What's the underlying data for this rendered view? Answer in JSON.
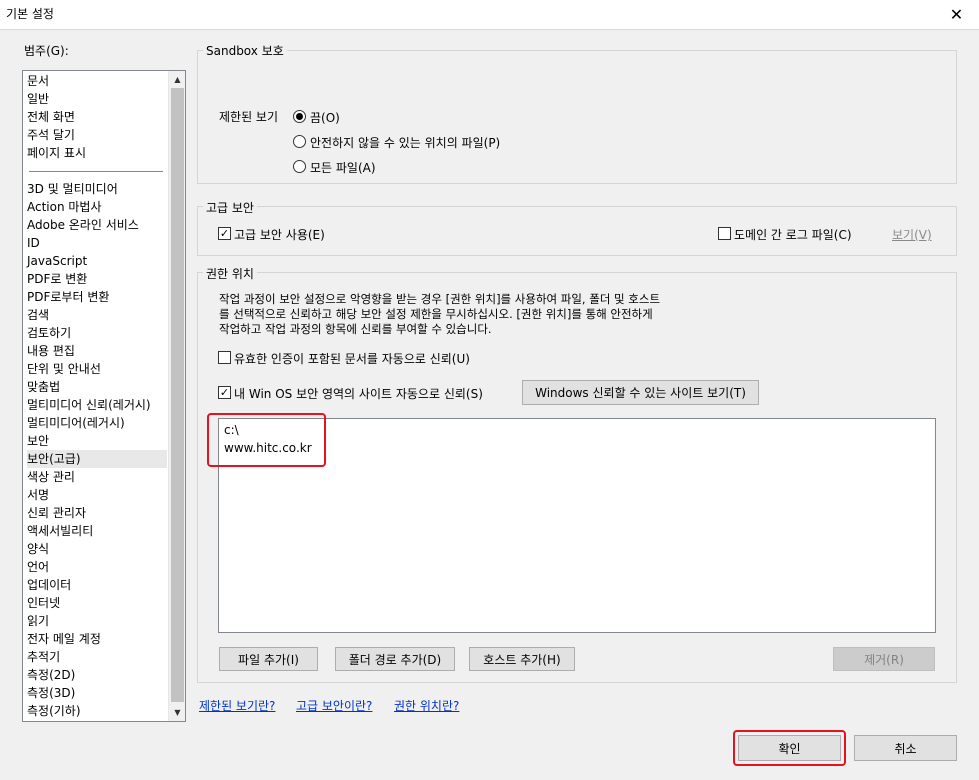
{
  "window": {
    "title": "기본 설정",
    "close": "✕"
  },
  "categories": {
    "label": "범주(G):",
    "items_top": [
      "문서",
      "일반",
      "전체 화면",
      "주석 달기",
      "페이지 표시"
    ],
    "items_bottom": [
      "3D 및 멀티미디어",
      "Action 마법사",
      "Adobe 온라인 서비스",
      "ID",
      "JavaScript",
      "PDF로 변환",
      "PDF로부터 변환",
      "검색",
      "검토하기",
      "내용 편집",
      "단위 및 안내선",
      "맞춤법",
      "멀티미디어 신뢰(레거시)",
      "멀티미디어(레거시)",
      "보안",
      "보안(고급)",
      "색상 관리",
      "서명",
      "신뢰 관리자",
      "액세서빌리티",
      "양식",
      "언어",
      "업데이터",
      "인터넷",
      "읽기",
      "전자 메일 계정",
      "추적기",
      "측정(2D)",
      "측정(3D)",
      "측정(기하)"
    ],
    "selected": "보안(고급)"
  },
  "sandbox": {
    "title": "Sandbox 보호",
    "protected_view_label": "제한된 보기",
    "options": [
      "끔(O)",
      "안전하지 않을 수 있는 위치의 파일(P)",
      "모든 파일(A)"
    ],
    "selected_index": 0
  },
  "enhanced": {
    "title": "고급 보안",
    "enable_label": "고급 보안 사용(E)",
    "enable_checked": true,
    "cross_domain_label": "도메인 간 로그 파일(C)",
    "cross_domain_checked": false,
    "view_link": "보기(V)"
  },
  "privileged": {
    "title": "권한 위치",
    "description": [
      "작업 과정이 보안 설정으로 악영향을 받는 경우 [권한 위치]를 사용하여 파일, 폴더 및 호스트",
      "를 선택적으로 신뢰하고 해당 보안 설정 제한을 무시하십시오. [권한 위치]를 통해 안전하게",
      "작업하고 작업 과정의 항목에 신뢰를 부여할 수 있습니다."
    ],
    "trust_certified_label": "유효한 인증이 포함된 문서를 자동으로 신뢰(U)",
    "trust_certified_checked": false,
    "trust_os_label": "내 Win OS 보안 영역의 사이트 자동으로 신뢰(S)",
    "trust_os_checked": true,
    "view_trusted_sites_button": "Windows 신뢰할 수 있는 사이트 보기(T)",
    "locations": [
      "c:\\",
      "www.hitc.co.kr"
    ],
    "add_file_button": "파일 추가(I)",
    "add_folder_button": "폴더 경로 추가(D)",
    "add_host_button": "호스트 추가(H)",
    "remove_button": "제거(R)"
  },
  "help_links": [
    "제한된 보기란?",
    "고급 보안이란?",
    "권한 위치란?"
  ],
  "footer": {
    "ok": "확인",
    "cancel": "취소"
  },
  "colors": {
    "accent_highlight": "#e3141f",
    "link": "#0033cc"
  }
}
